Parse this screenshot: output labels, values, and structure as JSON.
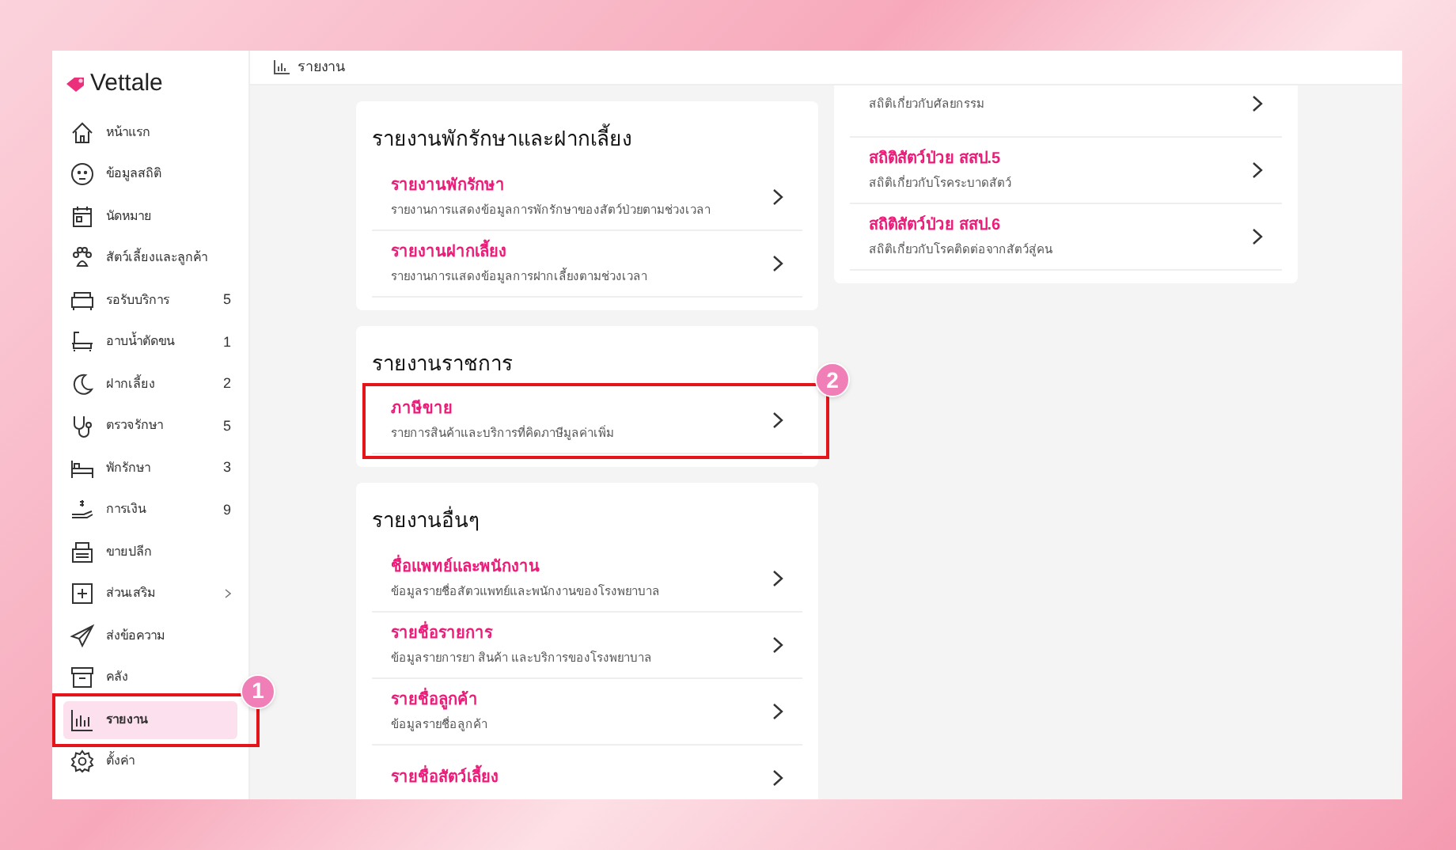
{
  "app": {
    "logo": "Vettale"
  },
  "header": {
    "breadcrumb": "รายงาน"
  },
  "sidebar": {
    "items": [
      {
        "label": "หน้าแรก",
        "selected": false
      },
      {
        "label": "ข้อมูลสถิติ",
        "selected": false
      },
      {
        "label": "นัดหมาย",
        "selected": false
      },
      {
        "label": "สัตว์เลี้ยงและลูกค้า",
        "selected": false
      },
      {
        "label": "รอรับบริการ",
        "count": "5",
        "selected": false
      },
      {
        "label": "อาบน้ำตัดขน",
        "count": "1",
        "selected": false
      },
      {
        "label": "ฝากเลี้ยง",
        "count": "2",
        "selected": false
      },
      {
        "label": "ตรวจรักษา",
        "count": "5",
        "selected": false
      },
      {
        "label": "พักรักษา",
        "count": "3",
        "selected": false
      },
      {
        "label": "การเงิน",
        "count": "9",
        "selected": false
      },
      {
        "label": "ขายปลีก",
        "selected": false
      },
      {
        "label": "ส่วนเสริม",
        "expandable": true,
        "selected": false
      },
      {
        "label": "ส่งข้อความ",
        "selected": false
      },
      {
        "label": "คลัง",
        "selected": false
      },
      {
        "label": "รายงาน",
        "selected": true,
        "callout": "1"
      },
      {
        "label": "ตั้งค่า",
        "selected": false
      }
    ]
  },
  "left_column": [
    {
      "heading": "รายงานพักรักษาและฝากเลี้ยง",
      "rows": [
        {
          "title": "รายงานพักรักษา",
          "subtitle": "รายงานการแสดงข้อมูลการพักรักษาของสัตว์ป่วยตามช่วงเวลา"
        },
        {
          "title": "รายงานฝากเลี้ยง",
          "subtitle": "รายงานการแสดงข้อมูลการฝากเลี้ยงตามช่วงเวลา"
        }
      ]
    },
    {
      "heading": "รายงานราชการ",
      "rows": [
        {
          "title": "ภาษีขาย",
          "subtitle": "รายการสินค้าและบริการที่คิดภาษีมูลค่าเพิ่ม",
          "callout": "2"
        }
      ]
    },
    {
      "heading": "รายงานอื่นๆ",
      "rows": [
        {
          "title": "ชื่อแพทย์และพนักงาน",
          "subtitle": "ข้อมูลรายชื่อสัตวแพทย์และพนักงานของโรงพยาบาล"
        },
        {
          "title": "รายชื่อรายการ",
          "subtitle": "ข้อมูลรายการยา สินค้า และบริการของโรงพยาบาล"
        },
        {
          "title": "รายชื่อลูกค้า",
          "subtitle": "ข้อมูลรายชื่อลูกค้า"
        },
        {
          "title": "รายชื่อสัตว์เลี้ยง"
        }
      ]
    }
  ],
  "right_column": [
    {
      "rows": [
        {
          "subtitle": "สถิติเกี่ยวกับศัลยกรรม"
        },
        {
          "title": "สถิติสัตว์ป่วย สสป.5",
          "subtitle": "สถิติเกี่ยวกับโรคระบาดสัตว์"
        },
        {
          "title": "สถิติสัตว์ป่วย สสป.6",
          "subtitle": "สถิติเกี่ยวกับโรคติดต่อจากสัตว์สู่คน"
        }
      ]
    }
  ]
}
